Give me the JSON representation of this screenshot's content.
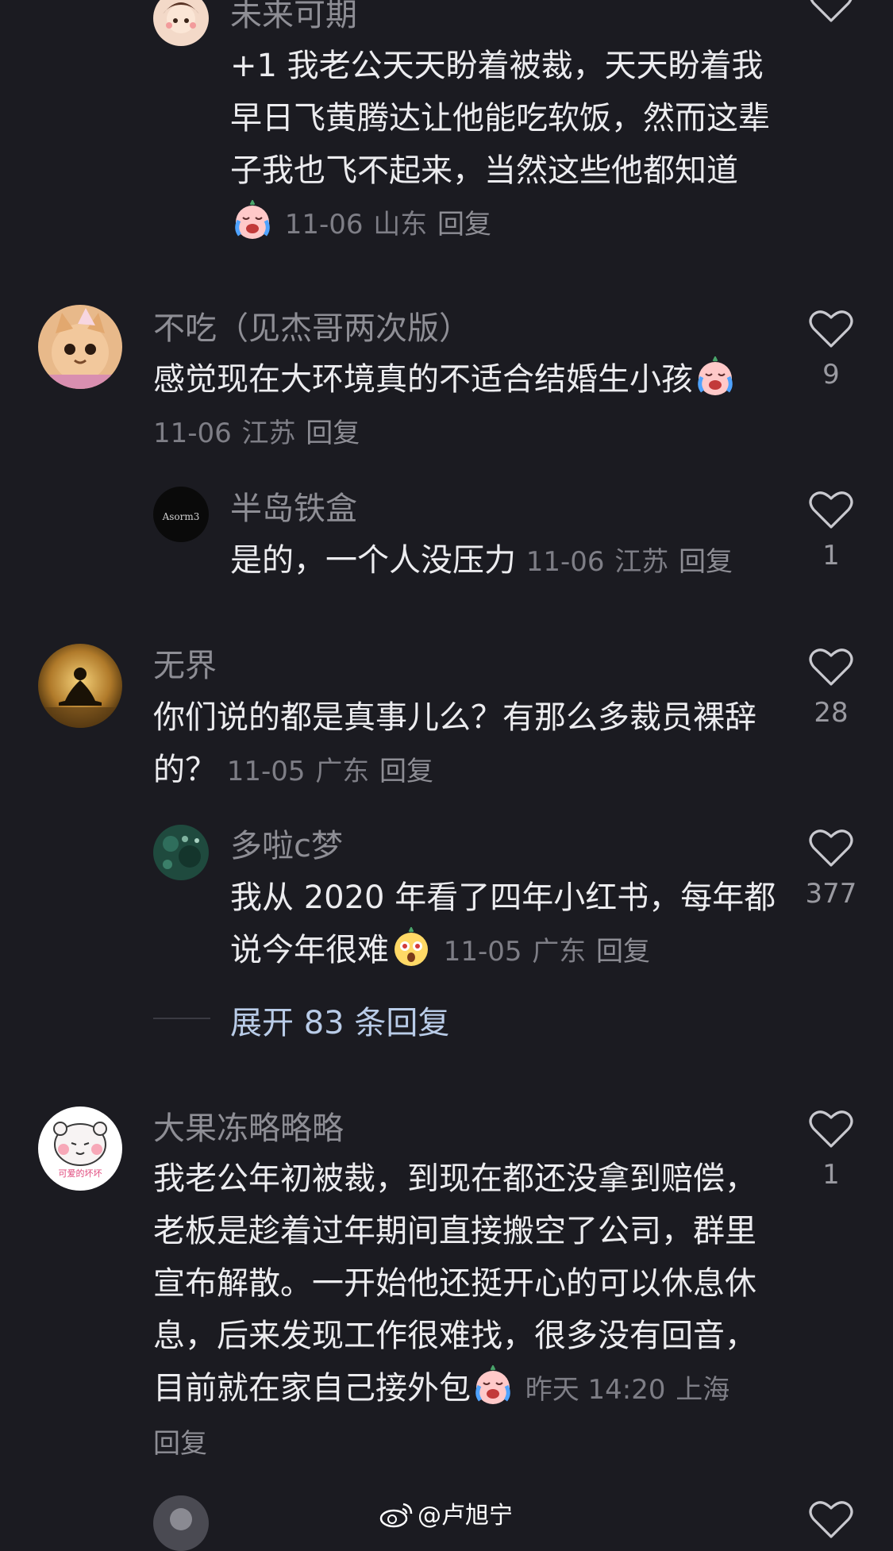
{
  "comments": [
    {
      "username": "未来可期",
      "text": "+1 我老公天天盼着被裁，天天盼着我早日飞黄腾达让他能吃软饭，然而这辈子我也飞不起来，当然这些他都知道",
      "emoji": "crying-emoji",
      "date": "11-06",
      "location": "山东",
      "reply_label": "回复"
    },
    {
      "username": "不吃（见杰哥两次版）",
      "text": "感觉现在大环境真的不适合结婚生小孩",
      "emoji": "crying-emoji",
      "date": "11-06",
      "location": "江苏",
      "reply_label": "回复",
      "likes": "9"
    },
    {
      "username": "半岛铁盒",
      "text": "是的，一个人没压力",
      "date": "11-06",
      "location": "江苏",
      "reply_label": "回复",
      "likes": "1"
    },
    {
      "username": "无界",
      "text": "你们说的都是真事儿么？有那么多裁员裸辞的？",
      "date": "11-05",
      "location": "广东",
      "reply_label": "回复",
      "likes": "28"
    },
    {
      "username": "多啦c梦",
      "text": "我从 2020 年看了四年小红书，每年都说今年很难",
      "emoji": "surprised-emoji",
      "date": "11-05",
      "location": "广东",
      "reply_label": "回复",
      "likes": "377"
    },
    {
      "username": "大果冻略略略",
      "text": "我老公年初被裁，到现在都还没拿到赔偿，老板是趁着过年期间直接搬空了公司，群里宣布解散。一开始他还挺开心的可以休息休息，后来发现工作很难找，很多没有回音，目前就在家自己接外包",
      "emoji": "crying-emoji",
      "date": "昨天 14:20",
      "location": "上海",
      "reply_label": "回复",
      "likes": "1",
      "avatar_caption": "可爱的坏坏"
    }
  ],
  "expand_replies": "展开 83 条回复",
  "watermark": "@卢旭宁",
  "colors": {
    "background": "#1b1b21",
    "expand_link": "#b9cce8",
    "meta_text": "#7e7e86"
  }
}
